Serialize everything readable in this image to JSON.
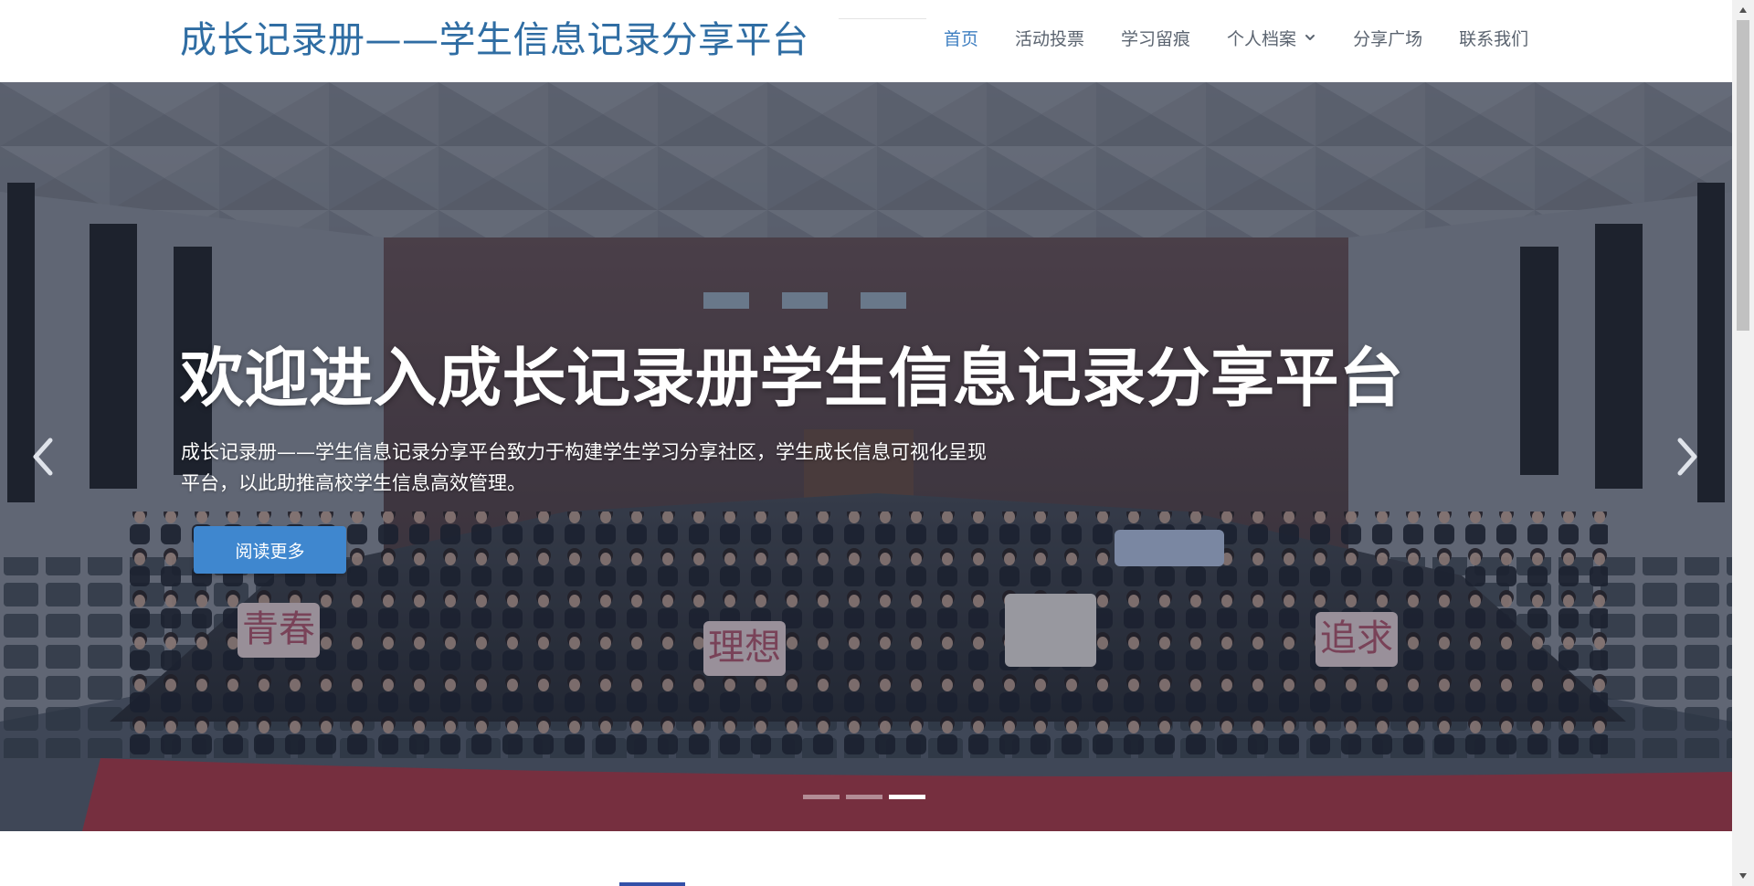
{
  "header": {
    "brand": "成长记录册——学生信息记录分享平台",
    "nav": [
      {
        "label": "首页",
        "active": true
      },
      {
        "label": "活动投票",
        "active": false
      },
      {
        "label": "学习留痕",
        "active": false
      },
      {
        "label": "个人档案",
        "active": false,
        "dropdown": true
      },
      {
        "label": "分享广场",
        "active": false
      },
      {
        "label": "联系我们",
        "active": false
      }
    ]
  },
  "hero": {
    "title": "欢迎进入成长记录册学生信息记录分享平台",
    "description": "成长记录册——学生信息记录分享平台致力于构建学生学习分享社区，学生成长信息可视化呈现平台，以此助推高校学生信息高效管理。",
    "button_label": "阅读更多",
    "prev_icon": "chevron-left-icon",
    "next_icon": "chevron-right-icon",
    "slides_total": 3,
    "active_slide": 3,
    "photo_signs": [
      "青春",
      "理想",
      "追求"
    ]
  },
  "colors": {
    "brand": "#2f6da3",
    "nav_active": "#3f7fc1",
    "nav_text": "#5b6470",
    "button": "#3f87cf",
    "banner_red": "#b23a4a"
  }
}
